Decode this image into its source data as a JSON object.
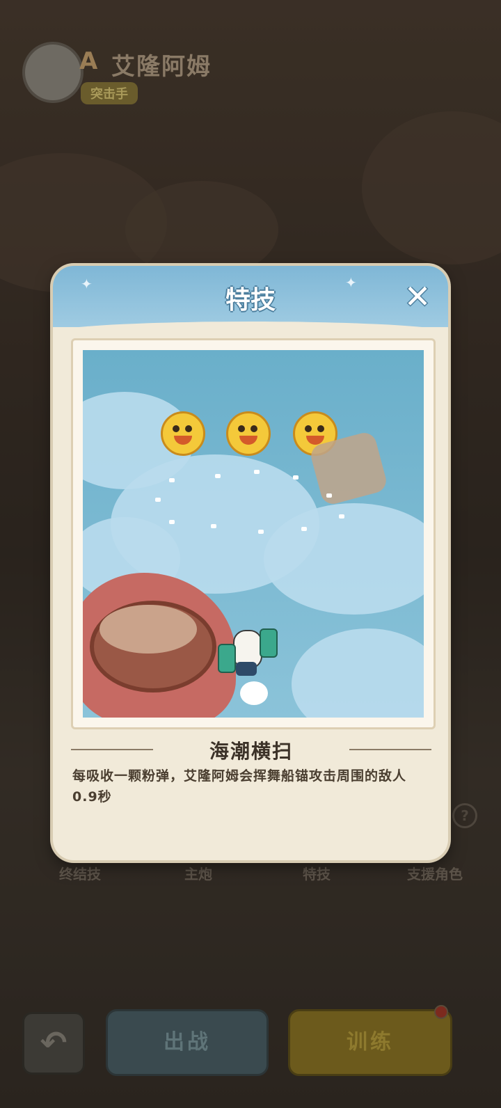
{
  "hero": {
    "grade": "A",
    "name": "艾隆阿姆",
    "role": "突击手"
  },
  "tabs": [
    "终结技",
    "主炮",
    "特技",
    "支援角色"
  ],
  "help_icon_glyph": "?",
  "bottom_bar": {
    "back_glyph": "↶",
    "sortie_label": "出战",
    "train_label": "训练"
  },
  "modal": {
    "title": "特技",
    "close_glyph": "✕",
    "skill_name": "海潮横扫",
    "skill_description": "每吸收一颗粉弹，艾隆阿姆会挥舞船锚攻击周围的敌人0.9秒"
  },
  "colors": {
    "header_blue": "#7fb7d6",
    "modal_bg": "#f1ead9",
    "train_yellow": "#6c5a1c"
  }
}
